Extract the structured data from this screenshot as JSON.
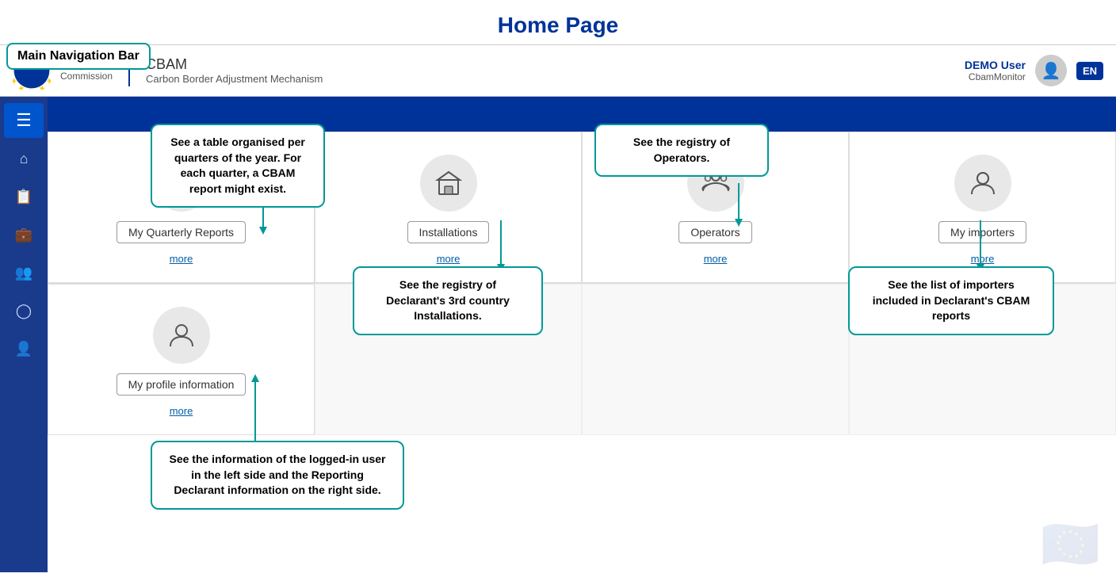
{
  "page": {
    "title": "Home Page"
  },
  "header": {
    "app_title": "CBAM",
    "app_subtitle": "Carbon Border Adjustment Mechanism",
    "user_name": "DEMO User",
    "user_role": "CbamMonitor",
    "lang": "EN"
  },
  "nav_bar_label": "Main Navigation Bar",
  "sidebar": {
    "items": [
      {
        "icon": "☰",
        "label": "Menu",
        "active": true
      },
      {
        "icon": "🏠",
        "label": "Home"
      },
      {
        "icon": "📋",
        "label": "Reports"
      },
      {
        "icon": "💼",
        "label": "Installations"
      },
      {
        "icon": "👥",
        "label": "Operators"
      },
      {
        "icon": "👤",
        "label": "Profile"
      },
      {
        "icon": "🔑",
        "label": "Access"
      }
    ]
  },
  "cards_row1": [
    {
      "icon": "📋",
      "label": "My Quarterly Reports",
      "more": "more"
    },
    {
      "icon": "💼",
      "label": "Installations",
      "more": "more"
    },
    {
      "icon": "👥",
      "label": "Operators",
      "more": "more"
    },
    {
      "icon": "👤",
      "label": "My importers",
      "more": "more"
    }
  ],
  "cards_row2": [
    {
      "icon": "👤",
      "label": "My profile information",
      "more": "more"
    },
    {
      "empty": true
    },
    {
      "empty": true
    },
    {
      "empty": true
    }
  ],
  "tooltips": [
    {
      "id": "tooltip-quarterly",
      "text": "See a table organised per quarters of the year. For each quarter, a CBAM report might exist."
    },
    {
      "id": "tooltip-installations",
      "text": "See the registry of Declarant's 3rd country  Installations."
    },
    {
      "id": "tooltip-operators",
      "text": "See the registry of Operators."
    },
    {
      "id": "tooltip-importers",
      "text": "See the list of importers included in Declarant's CBAM reports"
    },
    {
      "id": "tooltip-profile",
      "text": "See the information of the logged-in user in the left side and the Reporting Declarant information on the right side."
    }
  ]
}
